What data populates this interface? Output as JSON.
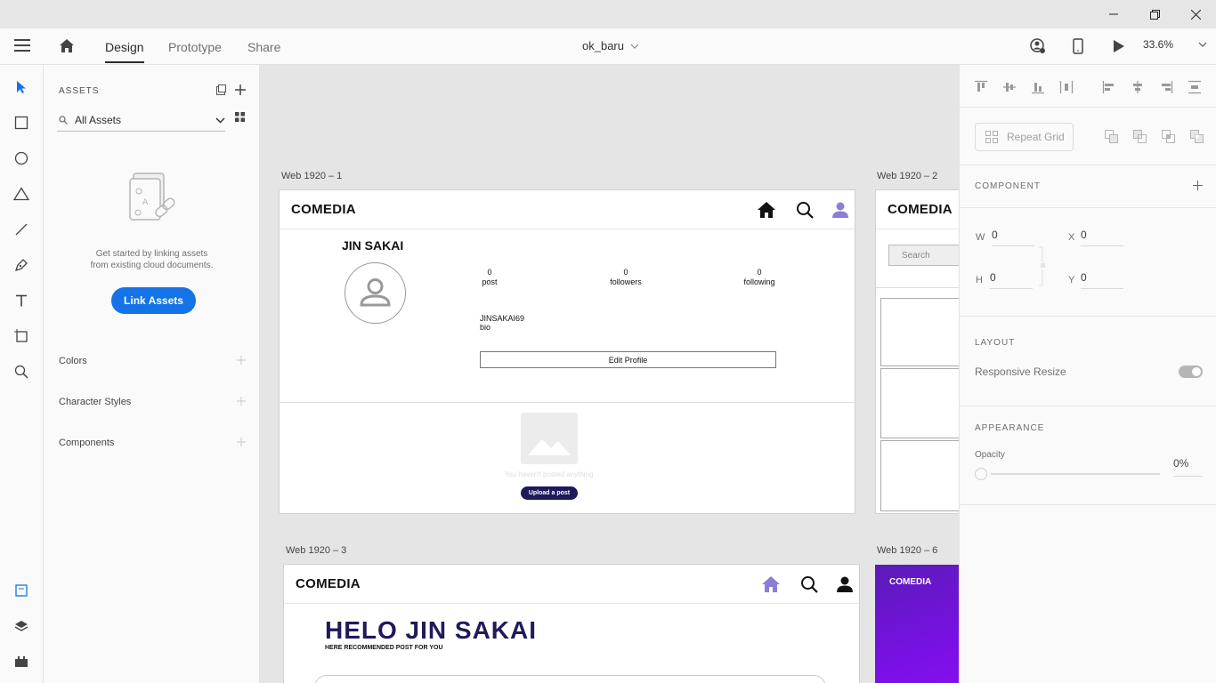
{
  "window": {
    "minimize_glyph": "—",
    "maximize_glyph": "❐",
    "close_glyph": "✕"
  },
  "toolbar": {
    "tabs": [
      "Design",
      "Prototype",
      "Share"
    ],
    "document_title": "ok_baru",
    "zoom": "33.6%"
  },
  "assets": {
    "title": "ASSETS",
    "filter": "All Assets",
    "empty_text_line1": "Get started by linking assets",
    "empty_text_line2": "from existing cloud documents.",
    "link_button": "Link Assets",
    "sections": [
      "Colors",
      "Character Styles",
      "Components"
    ]
  },
  "canvas": {
    "artboards": {
      "ab1": {
        "label": "Web 1920 – 1",
        "brand": "COMEDIA",
        "profile_name": "JIN SAKAI",
        "stats": [
          {
            "value": "0",
            "label": "post"
          },
          {
            "value": "0",
            "label": "followers"
          },
          {
            "value": "0",
            "label": "following"
          }
        ],
        "username": "JINSAKAI69",
        "bio": "bio",
        "edit_profile": "Edit Profile",
        "empty_posts": "You haven't posted anything",
        "upload_button": "Upload a post"
      },
      "ab2": {
        "label": "Web 1920 – 2",
        "brand": "COMEDIA",
        "search_placeholder": "Search"
      },
      "ab3": {
        "label": "Web 1920 – 3",
        "brand": "COMEDIA",
        "greeting": "HELO JIN SAKAI",
        "subtitle": "HERE RECOMMENDED POST FOR YOU"
      },
      "ab6": {
        "label": "Web 1920 – 6",
        "brand": "COMEDIA"
      }
    }
  },
  "properties": {
    "repeat_grid": "Repeat Grid",
    "component_title": "COMPONENT",
    "w_label": "W",
    "w_value": "0",
    "x_label": "X",
    "x_value": "0",
    "h_label": "H",
    "h_value": "0",
    "y_label": "Y",
    "y_value": "0",
    "layout_title": "LAYOUT",
    "responsive_resize": "Responsive Resize",
    "appearance_title": "APPEARANCE",
    "opacity_label": "Opacity",
    "opacity_value": "0%"
  },
  "colors": {
    "accent_blue": "#1473e6",
    "navy": "#1e1a5c",
    "purple_home": "#8a7fd4",
    "purple_artboard": "#6a0fe0"
  }
}
